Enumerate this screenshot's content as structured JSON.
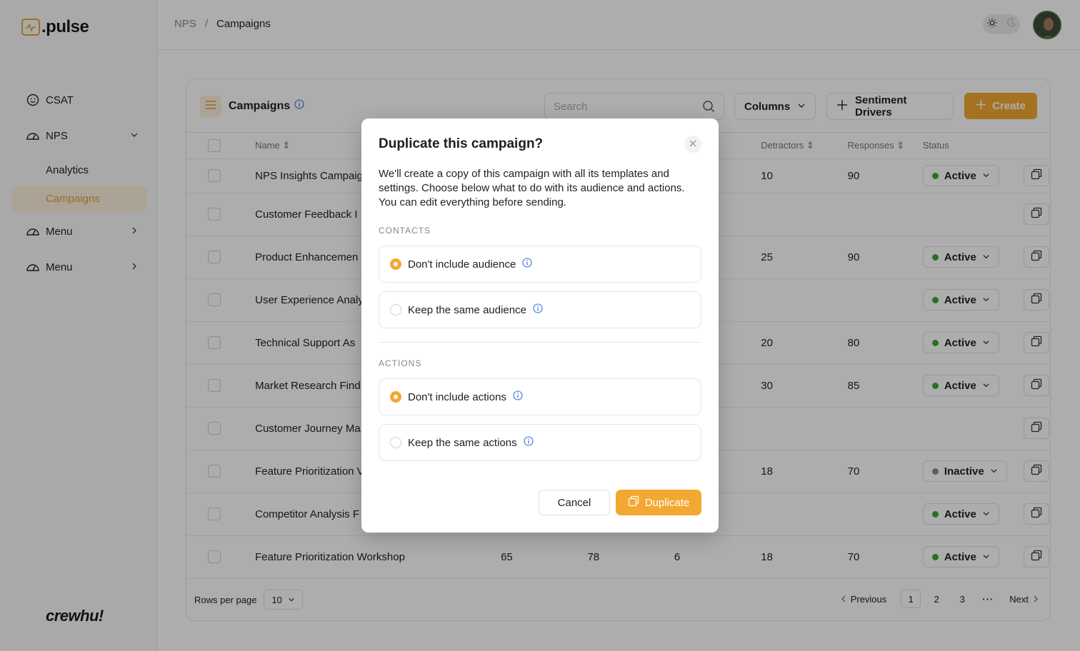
{
  "app": {
    "logo_text": ".pulse",
    "footer_brand": "crewhu!"
  },
  "sidebar": {
    "items": [
      {
        "label": "CSAT",
        "icon": "smile-icon"
      },
      {
        "label": "NPS",
        "icon": "gauge-icon",
        "expanded": true,
        "children": [
          {
            "label": "Analytics",
            "active": false
          },
          {
            "label": "Campaigns",
            "active": true
          }
        ]
      },
      {
        "label": "Menu",
        "icon": "gauge-icon"
      },
      {
        "label": "Menu",
        "icon": "gauge-icon"
      }
    ]
  },
  "header": {
    "breadcrumb": [
      "NPS",
      "/",
      "Campaigns"
    ]
  },
  "toolbar": {
    "title": "Campaigns",
    "search_placeholder": "Search",
    "columns_label": "Columns",
    "sentiment_label": "Sentiment Drivers",
    "create_label": "Create"
  },
  "table": {
    "headers": [
      "Name",
      "Detractors",
      "Responses",
      "Status"
    ],
    "rows": [
      {
        "name": "NPS Insights Campaig",
        "c1": "",
        "c2": "",
        "c3": "",
        "detractors": "10",
        "responses": "90",
        "status": "Active"
      },
      {
        "name": "Customer Feedback I",
        "c1": "",
        "c2": "",
        "c3": "",
        "detractors": "",
        "responses": "",
        "status": ""
      },
      {
        "name": "Product Enhancemen",
        "c1": "",
        "c2": "",
        "c3": "",
        "detractors": "25",
        "responses": "90",
        "status": "Active"
      },
      {
        "name": "User Experience Analy",
        "c1": "",
        "c2": "",
        "c3": "",
        "detractors": "",
        "responses": "",
        "status": "Active"
      },
      {
        "name": "Technical Support As",
        "c1": "",
        "c2": "",
        "c3": "",
        "detractors": "20",
        "responses": "80",
        "status": "Active"
      },
      {
        "name": "Market Research Find",
        "c1": "",
        "c2": "",
        "c3": "",
        "detractors": "30",
        "responses": "85",
        "status": "Active"
      },
      {
        "name": "Customer Journey Ma",
        "c1": "",
        "c2": "",
        "c3": "",
        "detractors": "",
        "responses": "",
        "status": ""
      },
      {
        "name": "Feature Prioritization V",
        "c1": "",
        "c2": "",
        "c3": "",
        "detractors": "18",
        "responses": "70",
        "status": "Inactive"
      },
      {
        "name": "Competitor Analysis F",
        "c1": "",
        "c2": "",
        "c3": "",
        "detractors": "",
        "responses": "",
        "status": "Active"
      },
      {
        "name": "Feature Prioritization Workshop",
        "c1": "65",
        "c2": "78",
        "c3": "6",
        "detractors": "18",
        "responses": "70",
        "status": "Active"
      }
    ]
  },
  "pagination": {
    "rows_per_page_label": "Rows per page",
    "rows_per_page_value": "10",
    "previous": "Previous",
    "pages": [
      "1",
      "2",
      "3"
    ],
    "ellipsis": "···",
    "next": "Next",
    "current_page": "1"
  },
  "modal": {
    "title": "Duplicate this campaign?",
    "description": "We'll create a copy of this campaign with all its templates and settings. Choose below what to do with its audience and actions. You can edit everything before sending.",
    "contacts_label": "CONTACTS",
    "contacts_options": [
      {
        "label": "Don't include audience",
        "selected": true
      },
      {
        "label": "Keep the same audience",
        "selected": false
      }
    ],
    "actions_label": "ACTIONS",
    "actions_options": [
      {
        "label": "Don't include actions",
        "selected": true
      },
      {
        "label": "Keep the same actions",
        "selected": false
      }
    ],
    "cancel_label": "Cancel",
    "duplicate_label": "Duplicate"
  },
  "colors": {
    "accent": "#f3a832",
    "active_dot": "#3aa832",
    "inactive_dot": "#8a8a8a",
    "overlay": "rgba(0,0,0,0.32)"
  }
}
